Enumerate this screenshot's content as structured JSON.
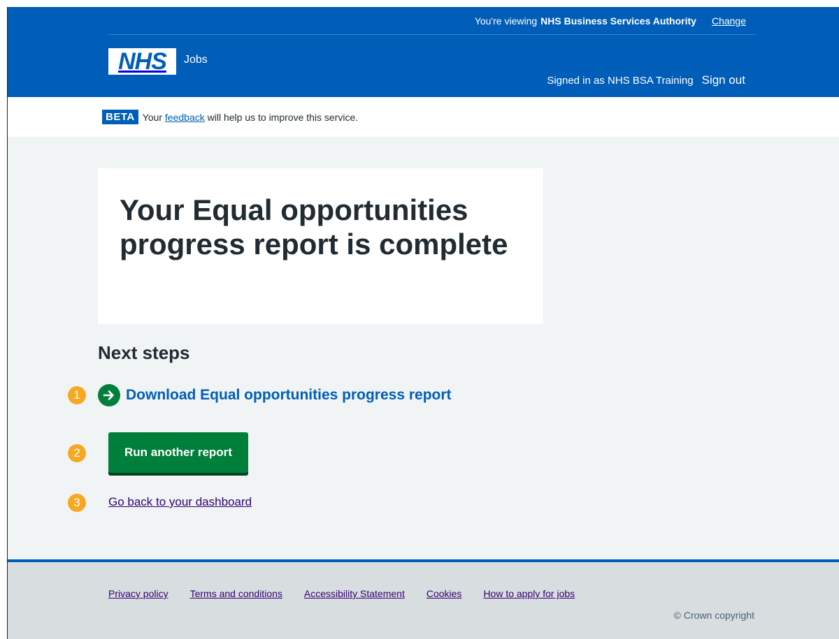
{
  "header": {
    "viewing_label": "You're viewing",
    "org_name": "NHS Business Services Authority",
    "change_link": "Change",
    "logo_text": "NHS",
    "service_name": "Jobs",
    "signed_in": "Signed in as NHS BSA Training",
    "sign_out": "Sign out",
    "brand_color": "#005eb8"
  },
  "beta_banner": {
    "tag": "BETA",
    "text_before": "Your",
    "link": "feedback",
    "text_after": "will help us to improve this service."
  },
  "panel": {
    "title": "Your Equal opportunities progress report is complete"
  },
  "next_steps": {
    "heading": "Next steps",
    "download_link": "Download Equal opportunities progress report",
    "run_button": "Run another report",
    "dashboard_link": "Go back to your dashboard",
    "markers": [
      "1",
      "2",
      "3"
    ],
    "marker_color": "#f7a823",
    "button_color": "#007f3b"
  },
  "footer": {
    "links": [
      "Privacy policy",
      "Terms and conditions",
      "Accessibility Statement",
      "Cookies",
      "How to apply for jobs"
    ],
    "copyright": "© Crown copyright"
  },
  "icons": {
    "arrow": "arrow-right-circle-icon"
  }
}
